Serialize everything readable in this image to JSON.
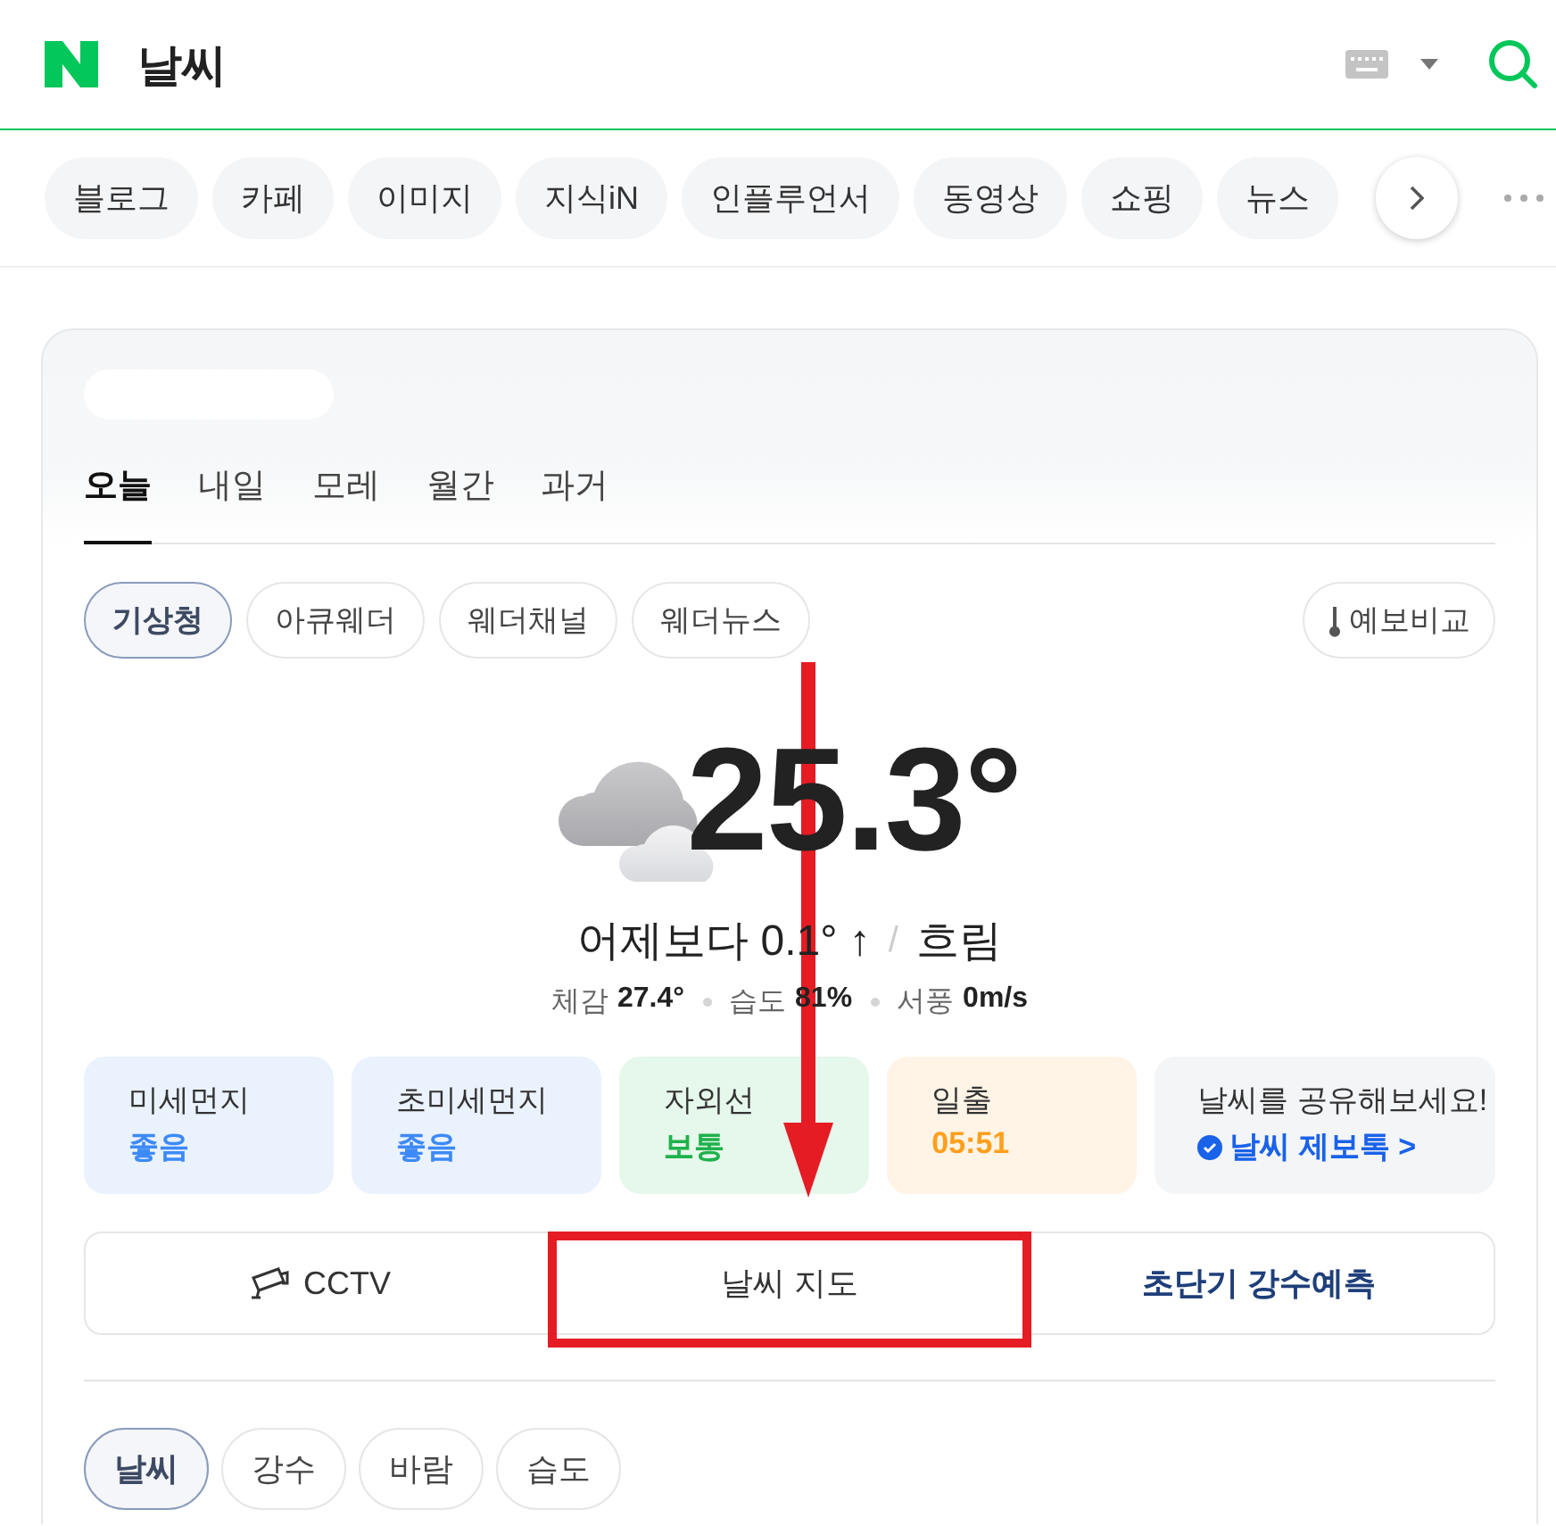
{
  "header": {
    "title": "날씨"
  },
  "verticals": [
    {
      "label": "블로그"
    },
    {
      "label": "카페"
    },
    {
      "label": "이미지"
    },
    {
      "label": "지식iN"
    },
    {
      "label": "인플루언서"
    },
    {
      "label": "동영상"
    },
    {
      "label": "쇼핑"
    },
    {
      "label": "뉴스"
    }
  ],
  "weather": {
    "day_tabs": [
      {
        "label": "오늘",
        "selected": true
      },
      {
        "label": "내일",
        "selected": false
      },
      {
        "label": "모레",
        "selected": false
      },
      {
        "label": "월간",
        "selected": false
      },
      {
        "label": "과거",
        "selected": false
      }
    ],
    "sources": [
      {
        "label": "기상청",
        "selected": true
      },
      {
        "label": "아큐웨더",
        "selected": false
      },
      {
        "label": "웨더채널",
        "selected": false
      },
      {
        "label": "웨더뉴스",
        "selected": false
      }
    ],
    "compare_button": {
      "label": "예보비교"
    },
    "temperature": "25.3°",
    "comparison": "어제보다 0.1° ↑",
    "separator": "/",
    "condition": "흐림",
    "details": [
      {
        "label": "체감",
        "value": "27.4°"
      },
      {
        "label": "습도",
        "value": "81%"
      },
      {
        "label": "서풍",
        "value": "0m/s"
      }
    ],
    "cards": [
      {
        "label": "미세먼지",
        "value": "좋음",
        "color": "#3d8af7"
      },
      {
        "label": "초미세먼지",
        "value": "좋음",
        "color": "#3d8af7"
      },
      {
        "label": "자외선",
        "value": "보통",
        "color": "#1fb24b"
      },
      {
        "label": "일출",
        "value": "05:51",
        "color": "#ff9f1c"
      }
    ],
    "share": {
      "text": "날씨를 공유해보세요!",
      "link": "날씨 제보톡 >"
    },
    "links": [
      {
        "kind": "cctv",
        "label": "CCTV",
        "highlighted": false
      },
      {
        "kind": "plain",
        "label": "날씨 지도",
        "highlighted": true
      },
      {
        "kind": "strong",
        "label": "초단기 강수예측",
        "highlighted": false
      }
    ],
    "map_tabs": [
      {
        "label": "날씨",
        "selected": true
      },
      {
        "label": "강수",
        "selected": false
      },
      {
        "label": "바람",
        "selected": false
      },
      {
        "label": "습도",
        "selected": false
      }
    ]
  }
}
